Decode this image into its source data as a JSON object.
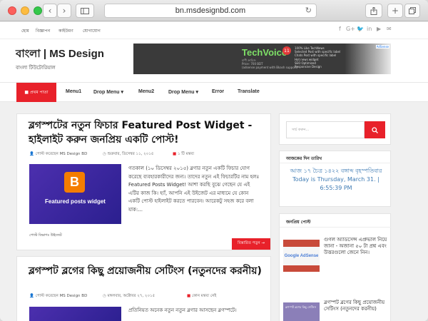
{
  "browser": {
    "url": "bn.msdesignbd.com",
    "back_icon": "chevron-left-icon",
    "forward_icon": "chevron-right-icon",
    "sidebar_icon": "sidebar-icon",
    "reload_icon": "reload-icon",
    "share_icon": "share-icon",
    "tabs_icon": "tabs-icon",
    "add_icon": "plus-icon"
  },
  "topbar": {
    "links": [
      "হোম",
      "বিজ্ঞাপন",
      "কাইউমণ",
      "যোগাযোগ"
    ],
    "social": [
      "f",
      "G+",
      "🐦",
      "in",
      "▶",
      "✉"
    ]
  },
  "header": {
    "site_title": "বাংলা | MS Design",
    "tagline": "বাংলা টিউটোরিয়াল"
  },
  "ad": {
    "brand": "TechVoice",
    "badge": "11",
    "features": [
      "100% Like TechNews",
      "Selected Post with specific label",
      "Chats Post with specific label",
      "Hot news widget",
      "SEO Optimized",
      "Responsive Design"
    ],
    "line1": "মার্শী ক্রাচিজ",
    "line2": "Price: 700 BDT",
    "line3": "(adsense payment with Bkash support)",
    "ad_flag": "AdSense"
  },
  "nav": {
    "home": "■ প্রথম পাতা",
    "items": [
      "Menu1",
      "Drop Menu ▾",
      "Menu2",
      "Drop Menu ▾",
      "Error",
      "Translate"
    ]
  },
  "posts": [
    {
      "title": "ব্লগস্পটের নতুন ফিচার Featured Post Widget - হাইলাইট করুন জনপ্রিয় একটি পোস্ট!",
      "author": "পোস্ট করেছেন MS Design BD",
      "date": "শুক্রবার, ডিসেম্বর ১১, ২০১৫",
      "comments": "১ টি মন্তব্য",
      "thumb_label": "Featured posts widget",
      "excerpt": "গতকাল (১০ ডিসেম্বর ২০১৫) ব্লগার নতুন একটি ফিচার যোগ করেছে ব্যবহারকারীদের জন্য। তাদের নতুন এই ফিচারটির নাম হলঃ Featured Posts Widget! আশা করছি বুঝে গেছেন যে এই এটির কাজ কি। হ্যাঁ, আপনি এই উইজেট এর মাধ্যমে যে কোন একটি পোস্ট হাইলাইট করতে পারবেন। আরেকটু সহজ করে বলা যাক:...",
      "label": "পোস্ট বিভাগঃ উইজেট",
      "read_more": "বিস্তারিত পড়ুন →"
    },
    {
      "title": "ব্লগস্পট ব্লগের কিছু প্রয়োজনীয় সেটিংস (নতুনদের করনীয়)",
      "author": "পোস্ট করেছেন MS Design BD",
      "date": "মঙ্গলবার, অক্টোবর ২৭, ২০১৫",
      "comments": "কোন মন্তব্য নেই",
      "excerpt": "প্রতিনিয়ত অনেক নতুন নতুন ব্লগার আসছেন ব্লগস্পটে।"
    }
  ],
  "sidebar": {
    "search_placeholder": "সার্চ করুন...",
    "date_widget_title": "আজকের দিন তারিখ",
    "date_line1": "আজ ১৭ চৈত্র ১৪২২ বঙ্গাব্দ বৃহস্পতিবার",
    "date_line2": "Today is Thursday, March 31. |",
    "date_line3": "6:55:39 PM",
    "popular_title": "জনপ্রিয় পোস্ট",
    "popular": [
      {
        "title": "গুগল অ্যাডসেন্স এপ্রুভাল নিয়ে জানা - অজানা ৫০ টা প্রশ্ন এবং উত্তরগুলো জেনে নিন।",
        "thumb_text": "Google AdSense"
      },
      {
        "title": "ব্লগস্পট ব্লগের কিছু প্রয়োজনীয় সেটিংস (নতুনদের করনীয়)",
        "thumb_text": "ব্লগস্পট ব্লগের কিছু সেটিংস"
      }
    ]
  },
  "colors": {
    "accent": "#e8212a",
    "date_blue": "#3d7ab3"
  }
}
